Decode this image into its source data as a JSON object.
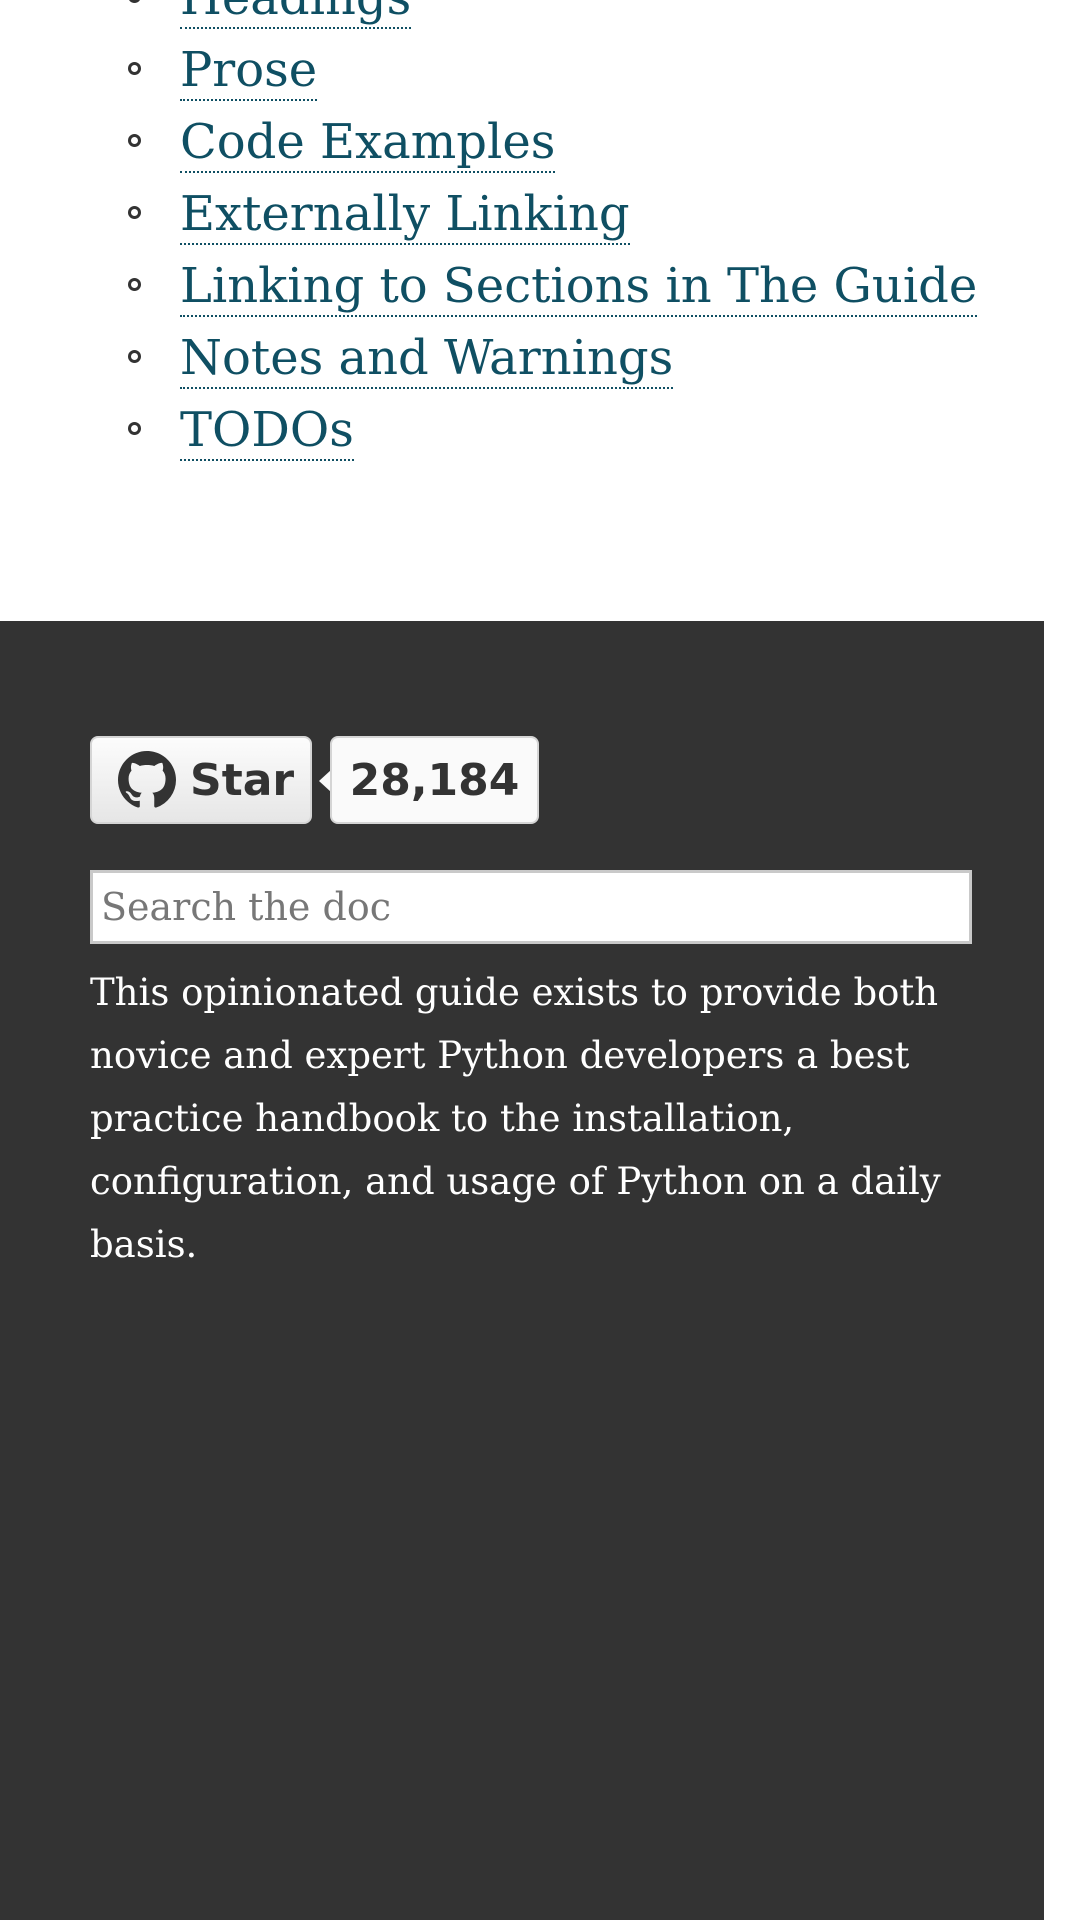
{
  "toc": {
    "items": [
      {
        "label": "Headings"
      },
      {
        "label": "Prose"
      },
      {
        "label": "Code Examples"
      },
      {
        "label": "Externally Linking"
      },
      {
        "label": "Linking to Sections in The Guide"
      },
      {
        "label": "Notes and Warnings"
      },
      {
        "label": "TODOs"
      }
    ]
  },
  "sidebar": {
    "github": {
      "icon": "github-icon",
      "star_label": "Star",
      "star_count": "28,184"
    },
    "search": {
      "placeholder": "Search the doc",
      "value": ""
    },
    "description": "This opinionated guide exists to provide both novice and expert Python developers a best practice handbook to the installation, configuration, and usage of Python on a daily basis."
  },
  "colors": {
    "link": "#0f4f63",
    "sidebar_background": "#333333",
    "sidebar_text": "#ffffff"
  }
}
